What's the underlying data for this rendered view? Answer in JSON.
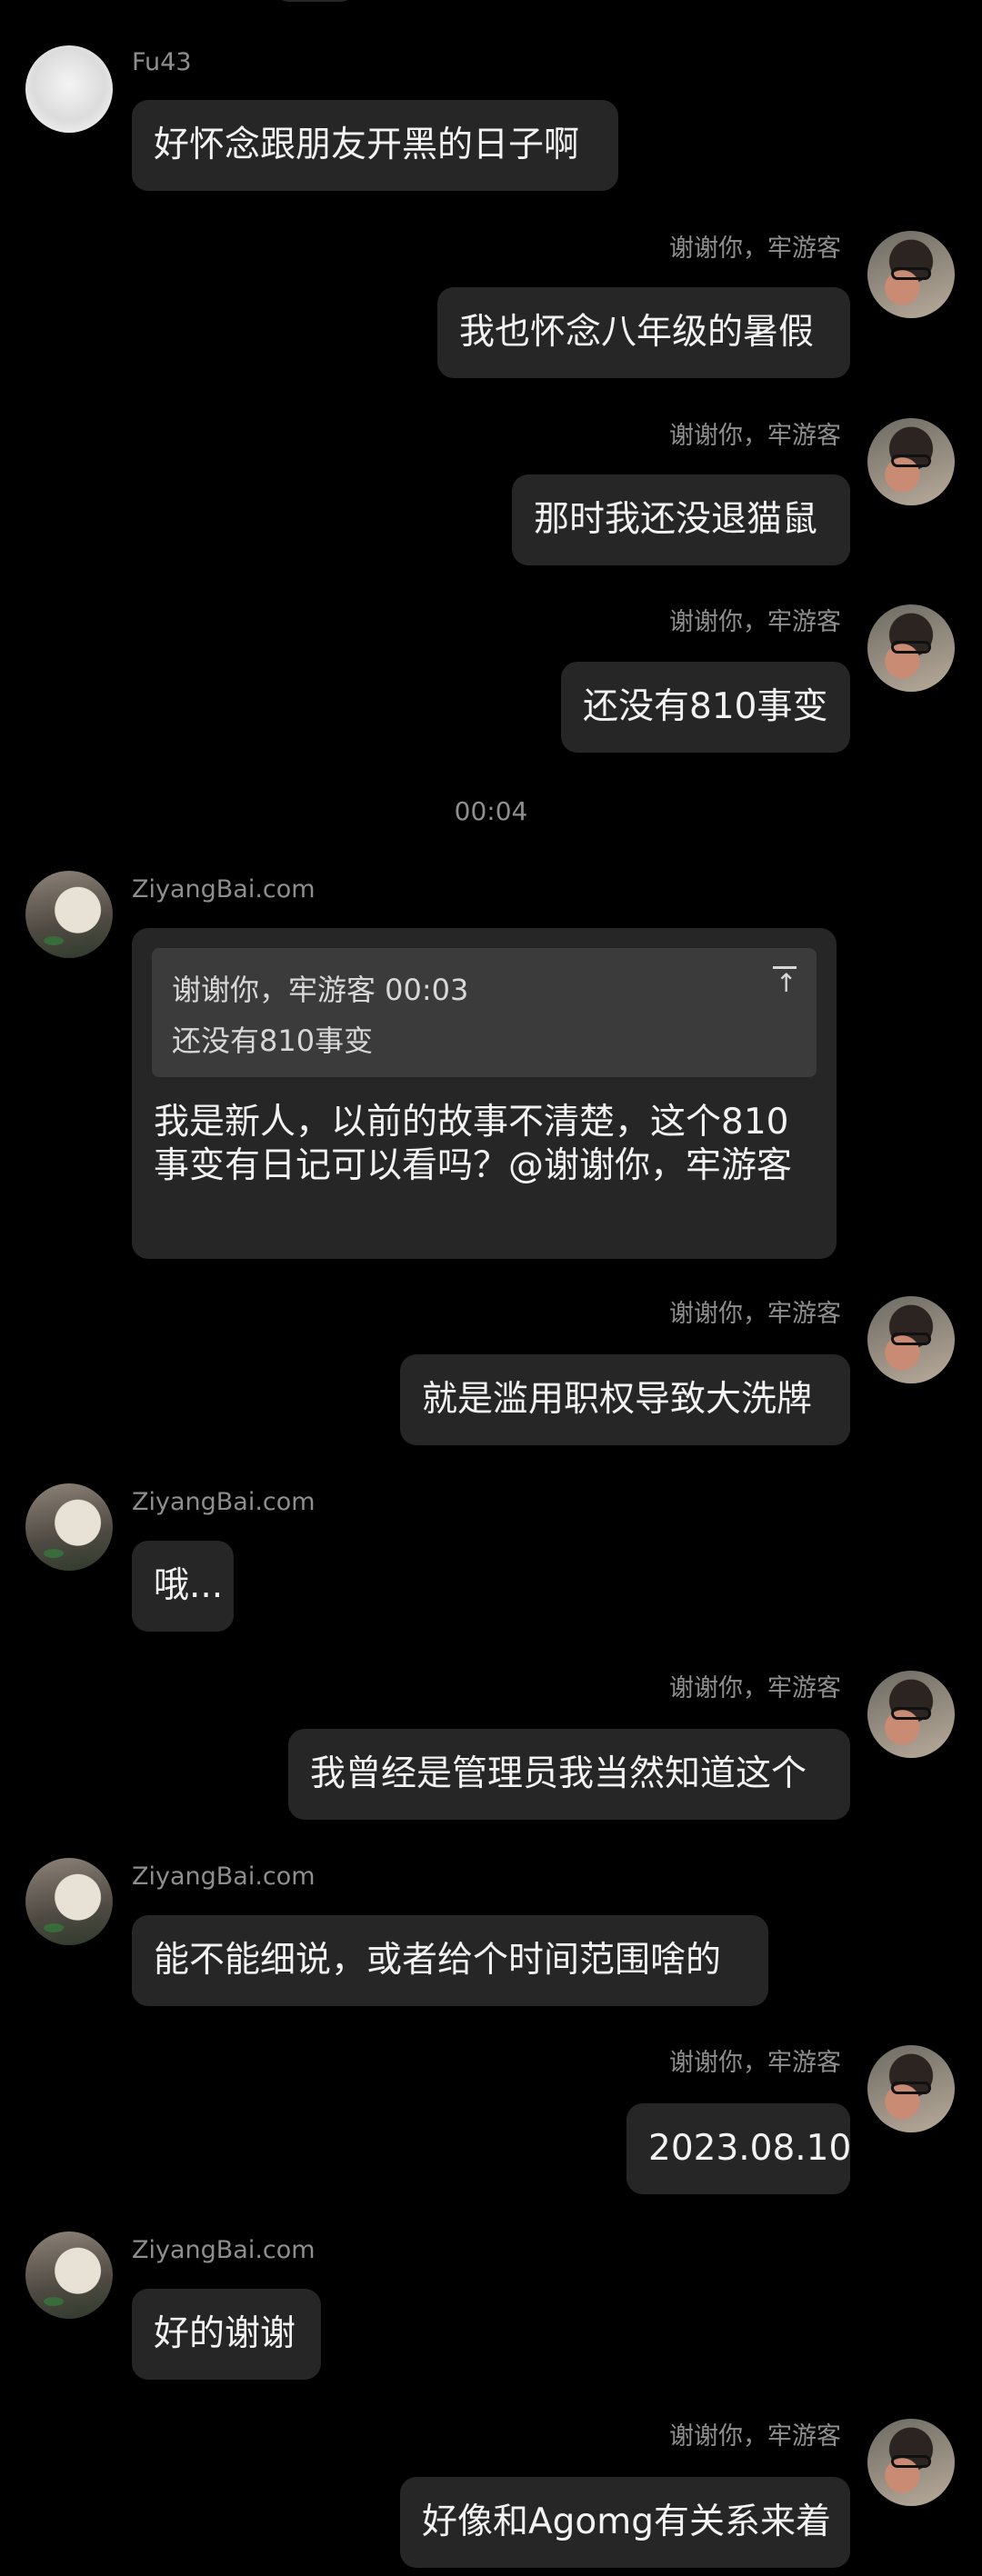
{
  "top_partial_bubble": "",
  "messages": [
    {
      "sender": "Fu43",
      "side": "left",
      "text": "好怀念跟朋友开黑的日子啊"
    },
    {
      "sender": "谢谢你，牢游客",
      "side": "right",
      "text": "我也怀念八年级的暑假"
    },
    {
      "sender": "谢谢你，牢游客",
      "side": "right",
      "text": "那时我还没退猫鼠"
    },
    {
      "sender": "谢谢你，牢游客",
      "side": "right",
      "text": "还没有810事变"
    },
    {
      "time_divider": "00:04"
    },
    {
      "sender": "ZiyangBai.com",
      "side": "left",
      "quote": {
        "header": "谢谢你，牢游客 00:03",
        "text": "还没有810事变"
      },
      "text": "我是新人，以前的故事不清楚，这个810事变有日记可以看吗？@谢谢你，牢游客"
    },
    {
      "sender": "谢谢你，牢游客",
      "side": "right",
      "text": "就是滥用职权导致大洗牌"
    },
    {
      "sender": "ZiyangBai.com",
      "side": "left",
      "text": "哦..."
    },
    {
      "sender": "谢谢你，牢游客",
      "side": "right",
      "text": "我曾经是管理员我当然知道这个"
    },
    {
      "sender": "ZiyangBai.com",
      "side": "left",
      "text": "能不能细说，或者给个时间范围啥的"
    },
    {
      "sender": "谢谢你，牢游客",
      "side": "right",
      "text": "2023.08.10"
    },
    {
      "sender": "ZiyangBai.com",
      "side": "left",
      "text": "好的谢谢"
    },
    {
      "sender": "谢谢你，牢游客",
      "side": "right",
      "text": "好像和Agomg有关系来着"
    }
  ]
}
